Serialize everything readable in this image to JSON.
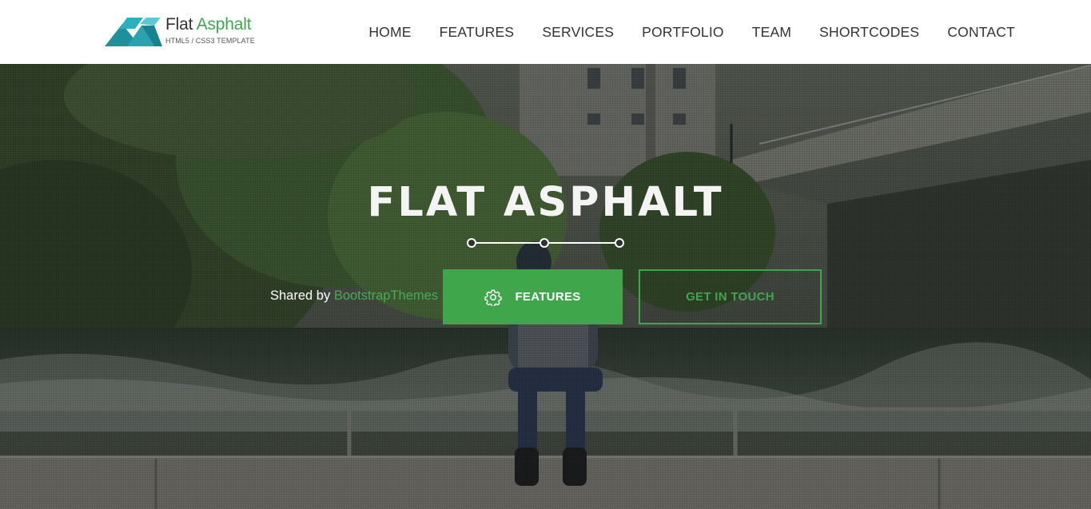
{
  "brand": {
    "name_part1": "Flat ",
    "name_part2": "Asphalt",
    "tagline": "HTML5 / CSS3 TEMPLATE",
    "accent_color": "#3fa64c",
    "logo_icon": "layered-triangles-logo"
  },
  "nav": {
    "items": [
      {
        "label": "HOME"
      },
      {
        "label": "FEATURES"
      },
      {
        "label": "SERVICES"
      },
      {
        "label": "PORTFOLIO"
      },
      {
        "label": "TEAM"
      },
      {
        "label": "SHORTCODES"
      },
      {
        "label": "CONTACT"
      }
    ]
  },
  "hero": {
    "title": "FLAT ASPHALT",
    "shared_prefix": "Shared by ",
    "shared_link": "BootstrapThemes",
    "primary_button": {
      "label": "FEATURES",
      "icon": "gear-icon"
    },
    "secondary_button": {
      "label": "GET IN TOUCH"
    },
    "background": "photo-person-sitting-on-riverside-wall"
  }
}
